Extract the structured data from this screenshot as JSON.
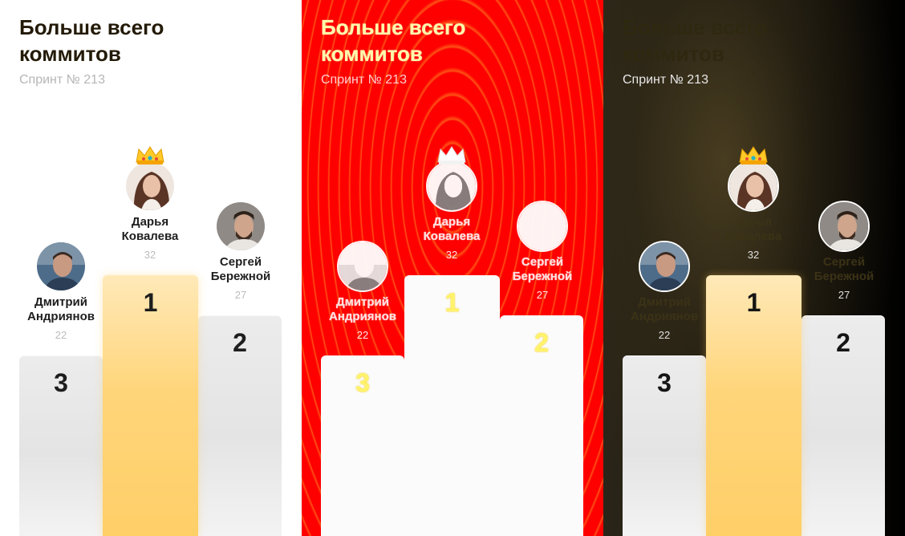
{
  "panels": [
    {
      "id": "light",
      "title": "Больше всего коммитов",
      "subtitle": "Спринт № 213"
    },
    {
      "id": "red",
      "title": "Больше всего коммитов",
      "subtitle": "Спринт № 213"
    },
    {
      "id": "dark",
      "title": "Больше всего коммитов",
      "subtitle": "Спринт № 213"
    }
  ],
  "leaders": {
    "first": {
      "name": "Дарья Ковалева",
      "score": "32",
      "place": "1"
    },
    "second": {
      "name": "Сергей Бережной",
      "score": "27",
      "place": "2"
    },
    "third": {
      "name": "Дмитрий Андриянов",
      "score": "22",
      "place": "3"
    }
  },
  "colors": {
    "gold": "#ffd57a",
    "pillar_gray": "#e8e8e8",
    "red_background": "#ff0000",
    "dark_background": "#1b170f"
  },
  "icons": {
    "crown": "crown-icon"
  }
}
